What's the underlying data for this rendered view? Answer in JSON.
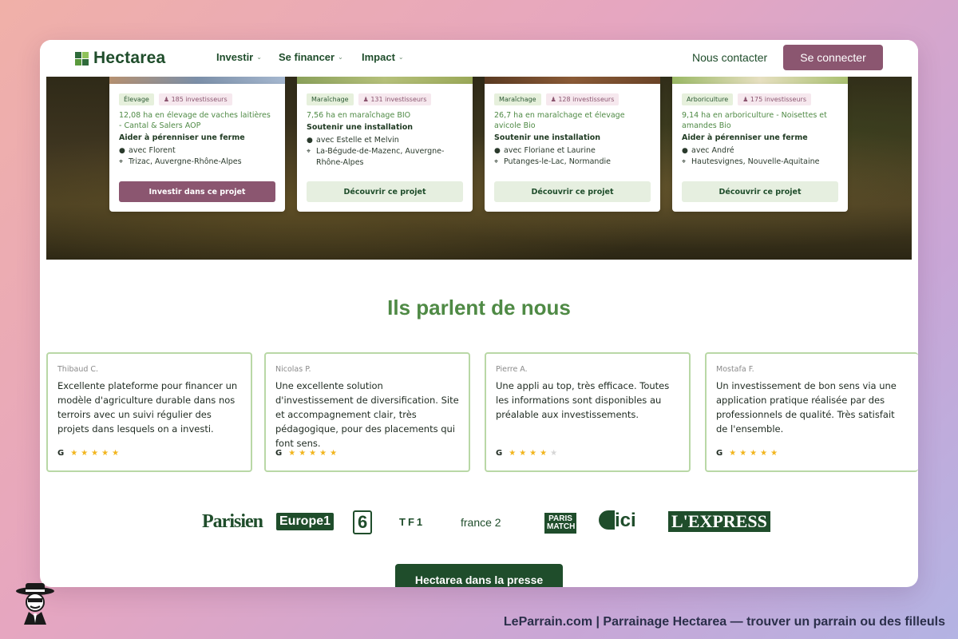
{
  "header": {
    "logo": "Hectarea",
    "nav": [
      {
        "label": "Investir"
      },
      {
        "label": "Se financer"
      },
      {
        "label": "Impact"
      }
    ],
    "contact": "Nous contacter",
    "connect": "Se connecter"
  },
  "projects": [
    {
      "category": "Élevage",
      "investors": "185 investisseurs",
      "title": "12,08 ha en élevage de vaches laitières - Cantal & Salers AOP",
      "subtitle": "Aider à pérenniser une ferme",
      "farmer": "avec Florent",
      "location": "Trizac, Auvergne-Rhône-Alpes",
      "button": "Investir dans ce projet"
    },
    {
      "category": "Maraîchage",
      "investors": "131 investisseurs",
      "title": "7,56 ha en maraîchage BIO",
      "subtitle": "Soutenir une installation",
      "farmer": "avec Estelle et Melvin",
      "location": "La-Bégude-de-Mazenc, Auvergne-Rhône-Alpes",
      "button": "Découvrir ce projet"
    },
    {
      "category": "Maraîchage",
      "investors": "128 investisseurs",
      "title": "26,7 ha en maraîchage et élevage avicole Bio",
      "subtitle": "Soutenir une installation",
      "farmer": "avec Floriane et Laurine",
      "location": "Putanges-le-Lac, Normandie",
      "button": "Découvrir ce projet"
    },
    {
      "category": "Arboriculture",
      "investors": "175 investisseurs",
      "title": "9,14 ha en arboriculture - Noisettes et amandes Bio",
      "subtitle": "Aider à pérenniser une ferme",
      "farmer": "avec André",
      "location": "Hautesvignes, Nouvelle-Aquitaine",
      "button": "Découvrir ce projet"
    }
  ],
  "testimonials": {
    "title": "Ils parlent de nous",
    "items": [
      {
        "name": "Thibaud C.",
        "text": "Excellente plateforme pour financer un modèle d'agriculture durable dans nos terroirs avec un suivi régulier des projets dans lesquels on a investi.",
        "rating": 5
      },
      {
        "name": "Nicolas P.",
        "text": "Une excellente solution d'investissement de diversification. Site et accompagnement clair, très pédagogique, pour des placements qui font sens.",
        "rating": 5
      },
      {
        "name": "Pierre A.",
        "text": "Une appli au top, très efficace. Toutes les informations sont disponibles au préalable aux investissements.",
        "rating": 4
      },
      {
        "name": "Mostafa F.",
        "text": "Un investissement de bon sens via une application pratique réalisée par des professionnels de qualité. Très satisfait de l'ensemble.",
        "rating": 5
      }
    ],
    "source_icon": "G"
  },
  "press": {
    "logos": [
      "Parisien",
      "Europe1",
      "6",
      "TF1",
      "france 2",
      "PARIS MATCH",
      "ici",
      "L'EXPRESS"
    ],
    "button": "Hectarea dans la presse"
  },
  "footer": {
    "caption": "LeParrain.com | Parrainage Hectarea — trouver un parrain ou des filleuls"
  },
  "colors": {
    "brand_green": "#1f4d2b",
    "accent_plum": "#8b5670",
    "light_green": "#e6efe0",
    "title_green": "#4f8a45"
  }
}
